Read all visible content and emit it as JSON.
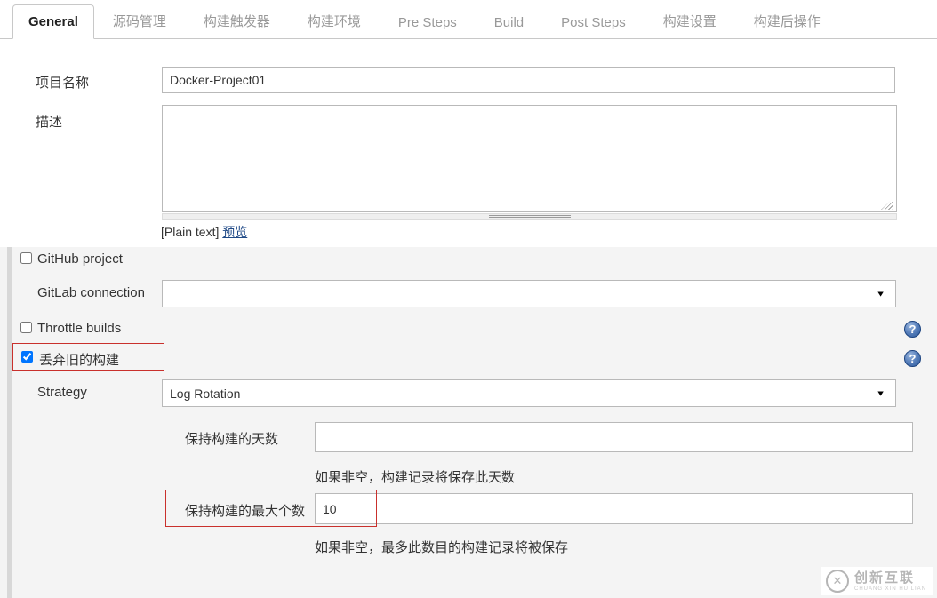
{
  "tabs": [
    {
      "label": "General",
      "active": true
    },
    {
      "label": "源码管理",
      "active": false
    },
    {
      "label": "构建触发器",
      "active": false
    },
    {
      "label": "构建环境",
      "active": false
    },
    {
      "label": "Pre Steps",
      "active": false
    },
    {
      "label": "Build",
      "active": false
    },
    {
      "label": "Post Steps",
      "active": false
    },
    {
      "label": "构建设置",
      "active": false
    },
    {
      "label": "构建后操作",
      "active": false
    }
  ],
  "form": {
    "project_name": {
      "label": "项目名称",
      "value": "Docker-Project01"
    },
    "description": {
      "label": "描述",
      "value": "",
      "mode_prefix": "[Plain text]",
      "preview_link": "预览"
    },
    "github_project": {
      "label": "GitHub project",
      "checked": false
    },
    "gitlab_connection": {
      "label": "GitLab connection",
      "selected_value": ""
    },
    "throttle_builds": {
      "label": "Throttle builds",
      "checked": false
    },
    "discard_old_builds": {
      "label": "丢弃旧的构建",
      "checked": true,
      "checked_attr": "checked"
    },
    "strategy": {
      "label": "Strategy",
      "selected_value": "Log Rotation"
    },
    "days_to_keep_builds": {
      "label": "保持构建的天数",
      "value": "",
      "help": "如果非空，构建记录将保存此天数"
    },
    "max_builds_to_keep": {
      "label": "保持构建的最大个数",
      "value": "10",
      "help": "如果非空，最多此数目的构建记录将被保存"
    }
  },
  "icons": {
    "help_icon_glyph": "?",
    "dropdown_arrow_glyph": "▼",
    "watermark_logo_glyph": "✕"
  },
  "watermark": {
    "brand": "创新互联",
    "subtitle": "CHUANG XIN HU LIAN"
  },
  "colors": {
    "highlight_red": "#c9302c",
    "link_blue": "#204a87",
    "help_icon_blue": "#2d5b9e",
    "inactive_tab_text": "#999999",
    "section_bg": "#f4f4f4"
  }
}
